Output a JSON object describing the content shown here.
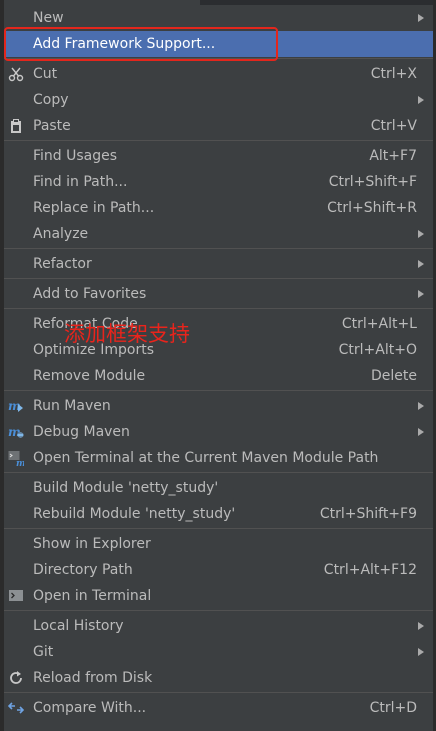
{
  "menu": {
    "items": [
      {
        "label": "New",
        "submenu": true
      },
      {
        "label": "Add Framework Support...",
        "highlighted": true
      },
      {
        "label": "Cut",
        "shortcut": "Ctrl+X",
        "icon": "scissors-icon"
      },
      {
        "label": "Copy",
        "submenu": true
      },
      {
        "label": "Paste",
        "shortcut": "Ctrl+V",
        "icon": "clipboard-icon"
      },
      {
        "label": "Find Usages",
        "shortcut": "Alt+F7"
      },
      {
        "label": "Find in Path...",
        "shortcut": "Ctrl+Shift+F"
      },
      {
        "label": "Replace in Path...",
        "shortcut": "Ctrl+Shift+R"
      },
      {
        "label": "Analyze",
        "submenu": true
      },
      {
        "label": "Refactor",
        "submenu": true
      },
      {
        "label": "Add to Favorites",
        "submenu": true
      },
      {
        "label": "Reformat Code",
        "shortcut": "Ctrl+Alt+L"
      },
      {
        "label": "Optimize Imports",
        "shortcut": "Ctrl+Alt+O"
      },
      {
        "label": "Remove Module",
        "shortcut": "Delete"
      },
      {
        "label": "Run Maven",
        "submenu": true,
        "icon": "maven-run-icon"
      },
      {
        "label": "Debug Maven",
        "submenu": true,
        "icon": "maven-debug-icon"
      },
      {
        "label": "Open Terminal at the Current Maven Module Path",
        "icon": "maven-terminal-icon"
      },
      {
        "label": "Build Module 'netty_study'"
      },
      {
        "label": "Rebuild Module 'netty_study'",
        "shortcut": "Ctrl+Shift+F9"
      },
      {
        "label": "Show in Explorer"
      },
      {
        "label": "Directory Path",
        "shortcut": "Ctrl+Alt+F12"
      },
      {
        "label": "Open in Terminal",
        "icon": "terminal-icon"
      },
      {
        "label": "Local History",
        "submenu": true
      },
      {
        "label": "Git",
        "submenu": true
      },
      {
        "label": "Reload from Disk",
        "icon": "reload-icon"
      },
      {
        "label": "Compare With...",
        "shortcut": "Ctrl+D",
        "icon": "compare-icon"
      }
    ]
  },
  "annotation": {
    "text": "添加框架支持"
  },
  "colors": {
    "background": "#3c3f41",
    "selection": "#4b6eaf",
    "text": "#bbbbbb",
    "highlight_box": "#e3261c",
    "annotation": "#e8241c"
  }
}
